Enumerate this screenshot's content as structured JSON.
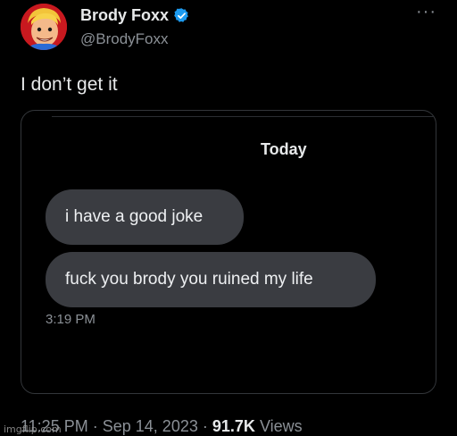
{
  "author": {
    "name": "Brody Foxx",
    "handle": "@BrodyFoxx",
    "verified": true,
    "avatar_icon": "cartoon-avatar-icon"
  },
  "more_label": "···",
  "tweet": {
    "text": "I don’t get it"
  },
  "screenshot": {
    "day_label": "Today",
    "messages": [
      {
        "text": "i have a good joke"
      },
      {
        "text": "fuck you brody you ruined my life"
      }
    ],
    "timestamp": "3:19 PM"
  },
  "meta": {
    "time": "11:25 PM",
    "sep1": "·",
    "date": "Sep 14, 2023",
    "sep2": "·",
    "views_count": "91.7K",
    "views_label": "Views"
  },
  "watermark": "imgflip.com",
  "colors": {
    "background": "#000000",
    "bubble": "#3a3c41",
    "verified": "#1d9bf0",
    "muted_text": "#8b9096"
  }
}
